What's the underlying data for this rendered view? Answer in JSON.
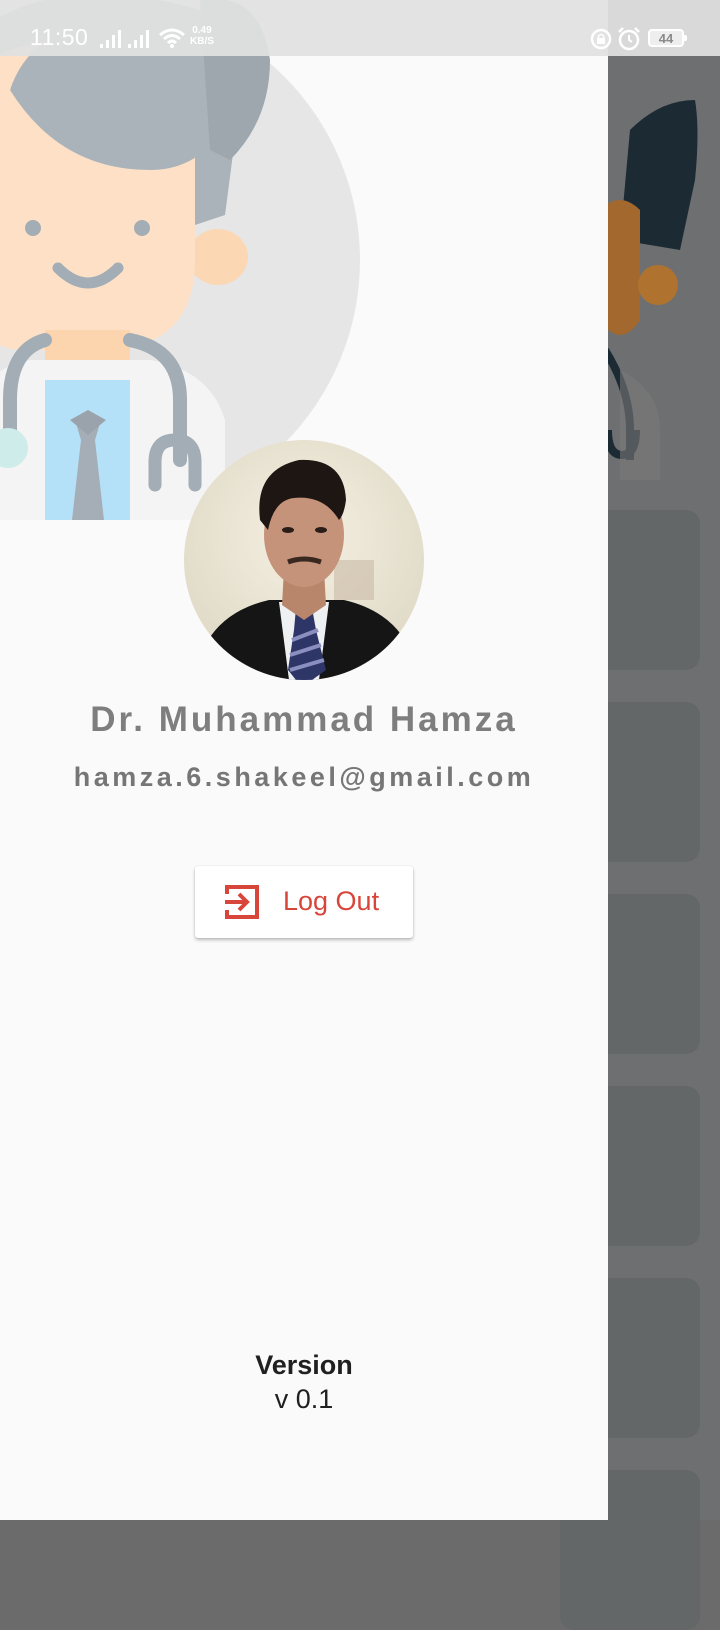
{
  "status_bar": {
    "time": "11:50",
    "net_speed_value": "0.49",
    "net_speed_unit": "KB/S",
    "battery": "44"
  },
  "drawer": {
    "header_illustration": "doctor-illustration",
    "profile_photo": "user-profile-photo",
    "name": "Dr. Muhammad Hamza",
    "email": "hamza.6.shakeel@gmail.com",
    "logout_label": "Log Out",
    "logout_icon": "logout-icon",
    "version_title": "Version",
    "version_value": "v 0.1"
  },
  "colors": {
    "drawer_background": "#fafafa",
    "logout_accent": "#d8463b",
    "name_text": "#7e7e7e",
    "scrim": "#6e6f70"
  }
}
